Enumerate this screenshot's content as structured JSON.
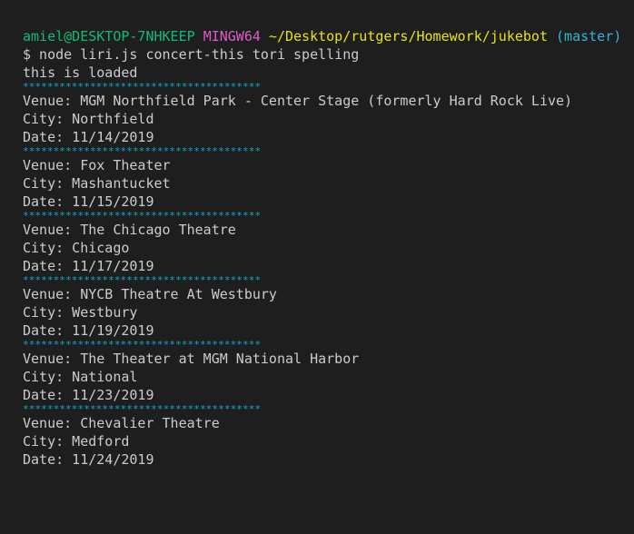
{
  "prompt": {
    "user_host": "amiel@DESKTOP-7NHKEEP",
    "system": "MINGW64",
    "path": "~/Desktop/rutgers/Homework/jukebot",
    "branch": "(master)"
  },
  "command": "$ node liri.js concert-this tori spelling",
  "loaded_message": "this is loaded",
  "separator": "***************************************",
  "colors": {
    "background": "#1e1e1e",
    "text": "#cccccc",
    "user_host": "#0dbc79",
    "system": "#e05bc9",
    "path": "#e5e510",
    "branch": "#29b8db",
    "separator": "#11a8cd"
  },
  "events": [
    {
      "venue": "Venue: MGM Northfield Park - Center Stage (formerly Hard Rock Live)",
      "city": "City: Northfield",
      "date": "Date: 11/14/2019"
    },
    {
      "venue": "Venue: Fox Theater",
      "city": "City: Mashantucket",
      "date": "Date: 11/15/2019"
    },
    {
      "venue": "Venue: The Chicago Theatre",
      "city": "City: Chicago",
      "date": "Date: 11/17/2019"
    },
    {
      "venue": "Venue: NYCB Theatre At Westbury",
      "city": "City: Westbury",
      "date": "Date: 11/19/2019"
    },
    {
      "venue": "Venue: The Theater at MGM National Harbor",
      "city": "City: National",
      "date": "Date: 11/23/2019"
    },
    {
      "venue": "Venue: Chevalier Theatre",
      "city": "City: Medford",
      "date": "Date: 11/24/2019"
    }
  ]
}
